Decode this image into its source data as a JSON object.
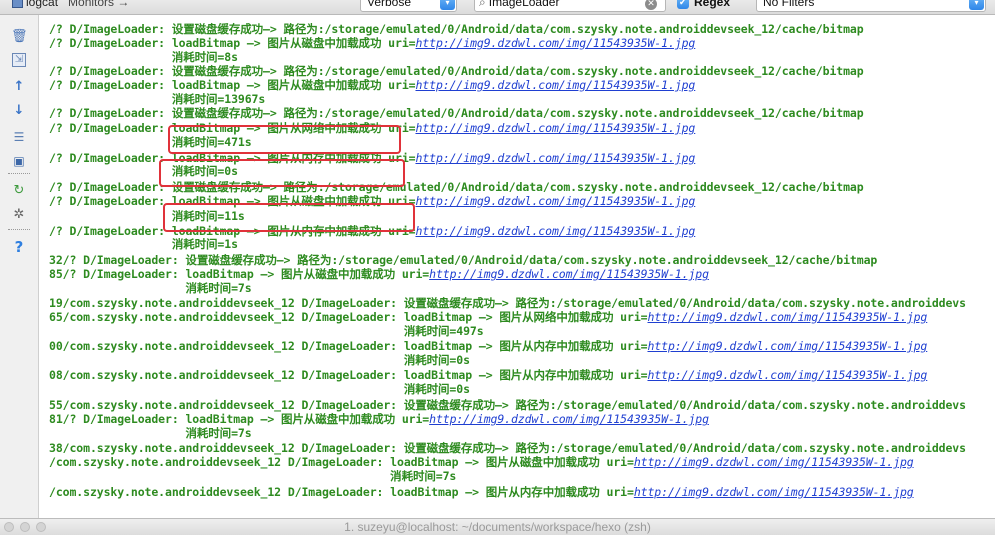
{
  "toolbar": {
    "logcat_tab": "logcat",
    "monitors_tab": "Monitors →",
    "level_select": "Verbose",
    "search_value": "ImageLoader",
    "regex_label": "Regex",
    "filter_select": "No Filters"
  },
  "sidebar": {
    "items": [
      "trash-icon",
      "soft-wrap-icon",
      "up-arrow-icon",
      "down-arrow-icon",
      "wrap-lines-icon",
      "screenshot-icon",
      "restart-icon",
      "settings-icon",
      "help-icon"
    ]
  },
  "log": {
    "lines": [
      {
        "text": "/? D/ImageLoader: 设置磁盘缓存成功—> 路径为:/storage/emulated/0/Android/data/com.szysky.note.androiddevseek_12/cache/bitmap",
        "url": ""
      },
      {
        "text": "/? D/ImageLoader: loadBitmap —> 图片从磁盘中加载成功 uri=",
        "url": "http://img9.dzdwl.com/img/11543935W-1.jpg"
      },
      {
        "text": "                  消耗时间=8s",
        "url": ""
      },
      {
        "text": "/? D/ImageLoader: 设置磁盘缓存成功—> 路径为:/storage/emulated/0/Android/data/com.szysky.note.androiddevseek_12/cache/bitmap",
        "url": ""
      },
      {
        "text": "/? D/ImageLoader: loadBitmap —> 图片从磁盘中加载成功 uri=",
        "url": "http://img9.dzdwl.com/img/11543935W-1.jpg"
      },
      {
        "text": "                  消耗时间=13967s",
        "url": ""
      },
      {
        "text": "/? D/ImageLoader: 设置磁盘缓存成功—> 路径为:/storage/emulated/0/Android/data/com.szysky.note.androiddevseek_12/cache/bitmap",
        "url": ""
      },
      {
        "text": "/? D/ImageLoader: loadBitmap —> 图片从网络中加载成功 uri=",
        "url": "http://img9.dzdwl.com/img/11543935W-1.jpg"
      },
      {
        "text": "                  消耗时间=471s",
        "url": ""
      },
      {
        "text": "/? D/ImageLoader: loadBitmap —> 图片从内存中加载成功 uri=",
        "url": "http://img9.dzdwl.com/img/11543935W-1.jpg"
      },
      {
        "text": "                  消耗时间=0s",
        "url": ""
      },
      {
        "text": "/? D/ImageLoader: 设置磁盘缓存成功—> 路径为:/storage/emulated/0/Android/data/com.szysky.note.androiddevseek_12/cache/bitmap",
        "url": ""
      },
      {
        "text": "/? D/ImageLoader: loadBitmap —> 图片从磁盘中加载成功 uri=",
        "url": "http://img9.dzdwl.com/img/11543935W-1.jpg"
      },
      {
        "text": "                  消耗时间=11s",
        "url": ""
      },
      {
        "text": "/? D/ImageLoader: loadBitmap —> 图片从内存中加载成功 uri=",
        "url": "http://img9.dzdwl.com/img/11543935W-1.jpg"
      },
      {
        "text": "                  消耗时间=1s",
        "url": ""
      },
      {
        "text": "32/? D/ImageLoader: 设置磁盘缓存成功—> 路径为:/storage/emulated/0/Android/data/com.szysky.note.androiddevseek_12/cache/bitmap",
        "url": ""
      },
      {
        "text": "85/? D/ImageLoader: loadBitmap —> 图片从磁盘中加载成功 uri=",
        "url": "http://img9.dzdwl.com/img/11543935W-1.jpg"
      },
      {
        "text": "                    消耗时间=7s",
        "url": ""
      },
      {
        "text": "19/com.szysky.note.androiddevseek_12 D/ImageLoader: 设置磁盘缓存成功—> 路径为:/storage/emulated/0/Android/data/com.szysky.note.androiddevs",
        "url": ""
      },
      {
        "text": "65/com.szysky.note.androiddevseek_12 D/ImageLoader: loadBitmap —> 图片从网络中加载成功 uri=",
        "url": "http://img9.dzdwl.com/img/11543935W-1.jpg"
      },
      {
        "text": "                                                    消耗时间=497s",
        "url": ""
      },
      {
        "text": "00/com.szysky.note.androiddevseek_12 D/ImageLoader: loadBitmap —> 图片从内存中加载成功 uri=",
        "url": "http://img9.dzdwl.com/img/11543935W-1.jpg"
      },
      {
        "text": "                                                    消耗时间=0s",
        "url": ""
      },
      {
        "text": "08/com.szysky.note.androiddevseek_12 D/ImageLoader: loadBitmap —> 图片从内存中加载成功 uri=",
        "url": "http://img9.dzdwl.com/img/11543935W-1.jpg"
      },
      {
        "text": "                                                    消耗时间=0s",
        "url": ""
      },
      {
        "text": "55/com.szysky.note.androiddevseek_12 D/ImageLoader: 设置磁盘缓存成功—> 路径为:/storage/emulated/0/Android/data/com.szysky.note.androiddevs",
        "url": ""
      },
      {
        "text": "81/? D/ImageLoader: loadBitmap —> 图片从磁盘中加载成功 uri=",
        "url": "http://img9.dzdwl.com/img/11543935W-1.jpg"
      },
      {
        "text": "                    消耗时间=7s",
        "url": ""
      },
      {
        "text": "38/com.szysky.note.androiddevseek_12 D/ImageLoader: 设置磁盘缓存成功—> 路径为:/storage/emulated/0/Android/data/com.szysky.note.androiddevs",
        "url": ""
      },
      {
        "text": "/com.szysky.note.androiddevseek_12 D/ImageLoader: loadBitmap —> 图片从磁盘中加载成功 uri=",
        "url": "http://img9.dzdwl.com/img/11543935W-1.jpg"
      },
      {
        "text": "                                                  消耗时间=7s",
        "url": ""
      },
      {
        "text": "/com.szysky.note.androiddevseek_12 D/ImageLoader: loadBitmap —> 图片从内存中加载成功 uri=",
        "url": "http://img9.dzdwl.com/img/11543935W-1.jpg"
      }
    ]
  },
  "terminal": {
    "title": "1. suzeyu@localhost: ~/documents/workspace/hexo (zsh)"
  },
  "colors": {
    "log_text": "#2e8b20",
    "url": "#1f3fd1",
    "highlight": "#e0323a"
  }
}
